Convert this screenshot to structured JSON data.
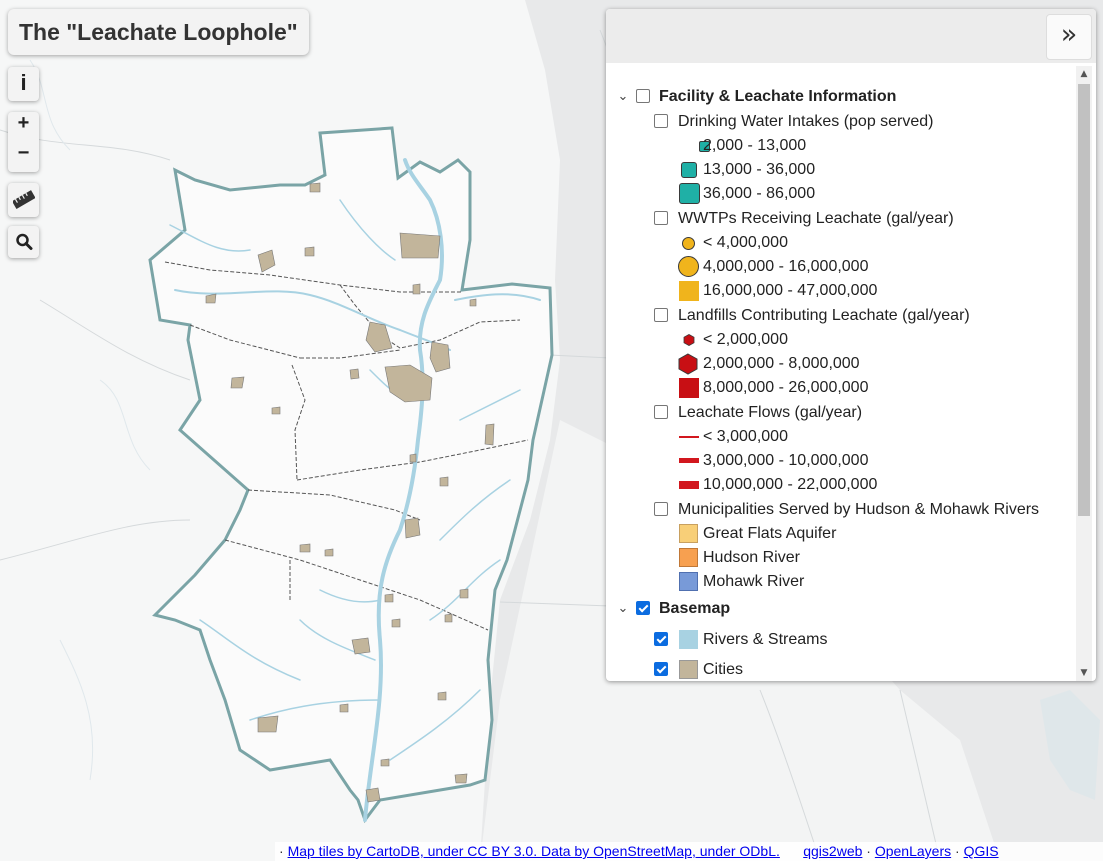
{
  "title": "The \"Leachate Loophole\"",
  "controls": {
    "info_label": "i",
    "zoom_in_label": "+",
    "zoom_out_label": "−",
    "measure_icon": "ruler-icon",
    "search_icon": "search-icon"
  },
  "colors": {
    "background": "#e8e9ea",
    "land": "#f6f7f7",
    "study_area_outline": "#7aa4a6",
    "rivers": "#a8d2e2",
    "cities": "#c2b59b",
    "intake": "#1fb0a6",
    "wwtp": "#f0b41c",
    "landfill": "#c80f14",
    "flow": "#d2171e",
    "great_flats": "#f8cf78",
    "hudson": "#f7a050",
    "mohawk": "#789ad8",
    "checkbox_checked": "#0b6ce0"
  },
  "layers_panel": {
    "collapse_label": "»",
    "scroll_up": "▲",
    "scroll_down": "▼",
    "groups": [
      {
        "label": "Facility & Leachate Information",
        "checked": false,
        "expanded": true,
        "layers": [
          {
            "label": "Drinking Water Intakes (pop served)",
            "checked": false,
            "legend": [
              {
                "symbol": "small-square",
                "label": "2,000 - 13,000"
              },
              {
                "symbol": "medium-square",
                "label": "13,000 - 36,000"
              },
              {
                "symbol": "large-square",
                "label": "36,000 - 86,000"
              }
            ]
          },
          {
            "label": "WWTPs Receiving Leachate (gal/year)",
            "checked": false,
            "legend": [
              {
                "symbol": "small-circle",
                "label": "< 4,000,000"
              },
              {
                "symbol": "large-circle",
                "label": "4,000,000 - 16,000,000"
              },
              {
                "symbol": "square",
                "label": "16,000,000 - 47,000,000"
              }
            ]
          },
          {
            "label": "Landfills Contributing Leachate (gal/year)",
            "checked": false,
            "legend": [
              {
                "symbol": "small-hexagon",
                "label": "< 2,000,000"
              },
              {
                "symbol": "large-hexagon",
                "label": "2,000,000 - 8,000,000"
              },
              {
                "symbol": "square",
                "label": "8,000,000 - 26,000,000"
              }
            ]
          },
          {
            "label": "Leachate Flows (gal/year)",
            "checked": false,
            "legend": [
              {
                "symbol": "thin-line",
                "label": "< 3,000,000"
              },
              {
                "symbol": "medium-line",
                "label": "3,000,000 - 10,000,000"
              },
              {
                "symbol": "thick-line",
                "label": "10,000,000 - 22,000,000"
              }
            ]
          },
          {
            "label": "Municipalities Served by Hudson & Mohawk Rivers",
            "checked": false,
            "legend": [
              {
                "symbol": "fill-great-flats",
                "label": "Great Flats Aquifer"
              },
              {
                "symbol": "fill-hudson",
                "label": "Hudson River"
              },
              {
                "symbol": "fill-mohawk",
                "label": "Mohawk River"
              }
            ]
          }
        ]
      },
      {
        "label": "Basemap",
        "checked": true,
        "expanded": true,
        "layers": [
          {
            "label": "Rivers & Streams",
            "checked": true,
            "swatch": "rivers"
          },
          {
            "label": "Cities",
            "checked": true,
            "swatch": "cities"
          }
        ]
      }
    ]
  },
  "attribution": {
    "separator": "·",
    "tiles": "Map tiles by CartoDB, under CC BY 3.0. Data by OpenStreetMap, under ODbL.",
    "qgis2web": "qgis2web",
    "openlayers": "OpenLayers",
    "qgis": "QGIS"
  }
}
